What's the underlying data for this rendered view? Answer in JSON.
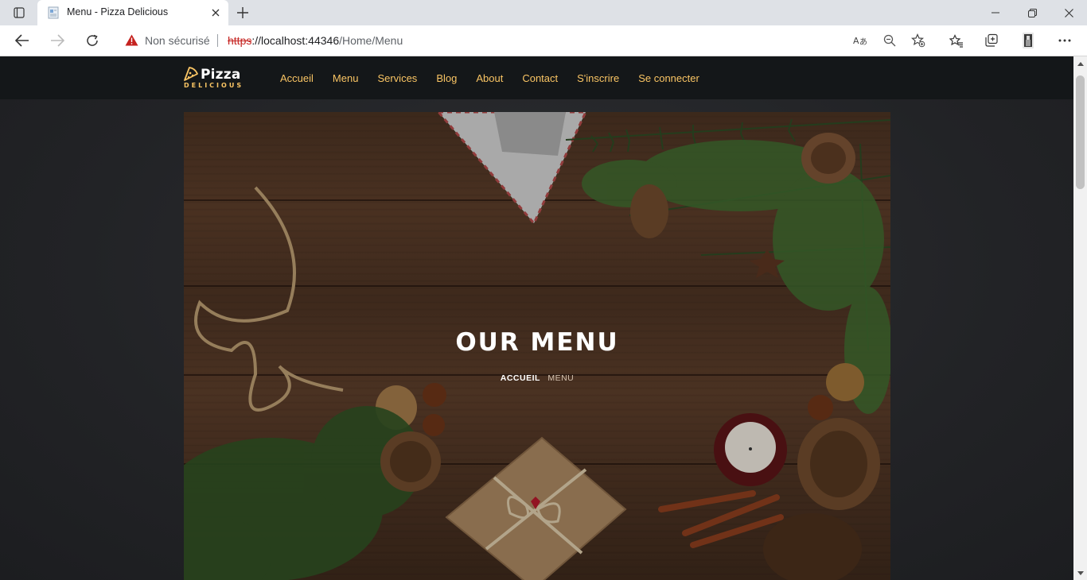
{
  "browser": {
    "tab": {
      "title": "Menu - Pizza Delicious"
    },
    "address_bar": {
      "security_label": "Non sécurisé",
      "url_scheme": "https",
      "url_host": "://localhost:44346",
      "url_path": "/Home/Menu"
    },
    "icons": {
      "tab_actions": "tab-actions-icon",
      "close_tab": "close-icon",
      "new_tab": "plus-icon",
      "back": "back-arrow-icon",
      "forward": "forward-arrow-icon",
      "refresh": "refresh-icon",
      "warning": "warning-icon",
      "read_aloud": "read-aloud-icon",
      "zoom": "zoom-out-icon",
      "add_favorite": "add-favorite-icon",
      "favorites": "favorites-icon",
      "collections": "collections-icon",
      "profile": "profile-icon",
      "menu": "more-icon",
      "minimize": "minimize-icon",
      "restore": "restore-icon",
      "close_window": "close-icon"
    }
  },
  "site": {
    "logo": {
      "name": "Pizza",
      "subtitle": "DELICIOUS"
    },
    "nav": [
      "Accueil",
      "Menu",
      "Services",
      "Blog",
      "About",
      "Contact",
      "S'inscrire",
      "Se connecter"
    ],
    "hero": {
      "title": "OUR MENU",
      "breadcrumb_home": "ACCUEIL",
      "breadcrumb_current": "MENU"
    }
  },
  "colors": {
    "accent": "#fac564",
    "header_bg": "#141719",
    "page_bg": "#222326",
    "warning_red": "#c5221f"
  }
}
